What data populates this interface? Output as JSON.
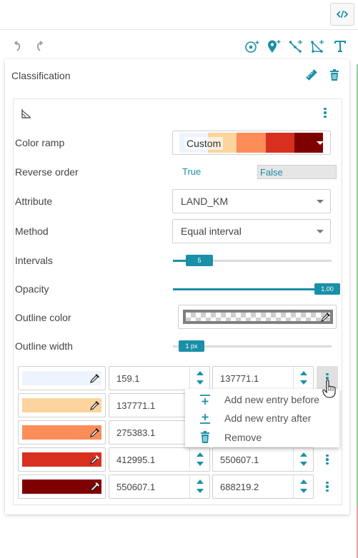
{
  "toolbar": {
    "code_icon": "code-icon",
    "undo_icon": "undo-icon",
    "redo_icon": "redo-icon",
    "tools": [
      "add-point-icon",
      "add-marker-icon",
      "draw-line-icon",
      "draw-polygon-icon",
      "add-text-icon"
    ]
  },
  "panel": {
    "title": "Classification",
    "edit_icon": "ruler-icon",
    "delete_icon": "trash-icon",
    "geometry_icon": "angle-icon"
  },
  "fields": {
    "color_ramp": {
      "label": "Color ramp",
      "value": "Custom",
      "colors": [
        "#eef4fd",
        "#fdd49e",
        "#fc8d59",
        "#d7301f",
        "#7f0000"
      ]
    },
    "reverse_order": {
      "label": "Reverse order",
      "true_label": "True",
      "false_label": "False",
      "selected": "False"
    },
    "attribute": {
      "label": "Attribute",
      "value": "LAND_KM"
    },
    "method": {
      "label": "Method",
      "value": "Equal interval"
    },
    "intervals": {
      "label": "Intervals",
      "value": "5",
      "level": 0.17
    },
    "opacity": {
      "label": "Opacity",
      "value": "1.00",
      "level": 1.0
    },
    "outline_color": {
      "label": "Outline color",
      "value": "#808080"
    },
    "outline_width": {
      "label": "Outline width",
      "value": "1 px",
      "level": 0.0
    }
  },
  "entries": [
    {
      "color": "#eef4fd",
      "min": "159.1",
      "max": "137771.1"
    },
    {
      "color": "#fdd49e",
      "min": "137771.1",
      "max": ""
    },
    {
      "color": "#fc8d59",
      "min": "275383.1",
      "max": ""
    },
    {
      "color": "#d7301f",
      "min": "412995.1",
      "max": "550607.1"
    },
    {
      "color": "#7f0000",
      "min": "550607.1",
      "max": "688219.2"
    }
  ],
  "context_menu": {
    "items": [
      {
        "label": "Add new entry before",
        "icon": "insert-before-icon"
      },
      {
        "label": "Add new entry after",
        "icon": "insert-after-icon"
      },
      {
        "label": "Remove",
        "icon": "trash-icon"
      }
    ]
  },
  "colors": {
    "accent": "#1a8fa8",
    "text": "#444444"
  }
}
